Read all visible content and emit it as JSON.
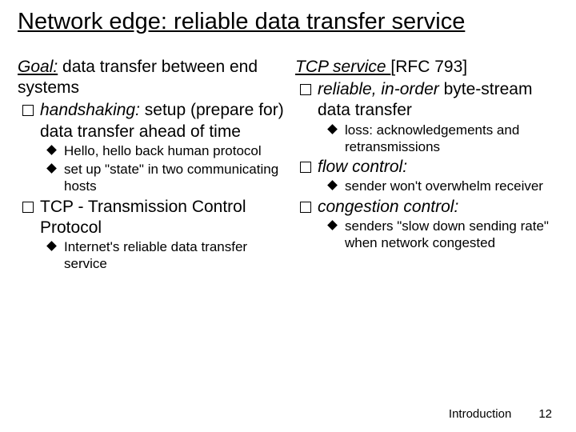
{
  "title": "Network edge: reliable data transfer service",
  "left": {
    "goal_label": "Goal:",
    "goal_rest": " data transfer between end systems",
    "b1": {
      "text_a": "handshaking:",
      "text_b": " setup (prepare for) data transfer ahead of time",
      "sub1": "Hello, hello back human protocol",
      "sub2_a": "set up ",
      "sub2_q": "\"state\"",
      "sub2_b": " in two communicating hosts"
    },
    "b2": {
      "text": "TCP - Transmission Control Protocol",
      "sub1": "Internet's reliable data transfer service"
    }
  },
  "right": {
    "hdr_a": "TCP service ",
    "hdr_b": "[RFC 793]",
    "b1": {
      "text_a": "reliable, in-order",
      "text_b": " byte-stream data transfer",
      "sub1": "loss: acknowledgements and retransmissions"
    },
    "b2": {
      "text": "flow control:",
      "sub1": "sender won't overwhelm receiver"
    },
    "b3": {
      "text": "congestion control:",
      "sub1": "senders \"slow down sending rate\" when network congested"
    }
  },
  "footer": {
    "label": "Introduction",
    "page": "12"
  }
}
